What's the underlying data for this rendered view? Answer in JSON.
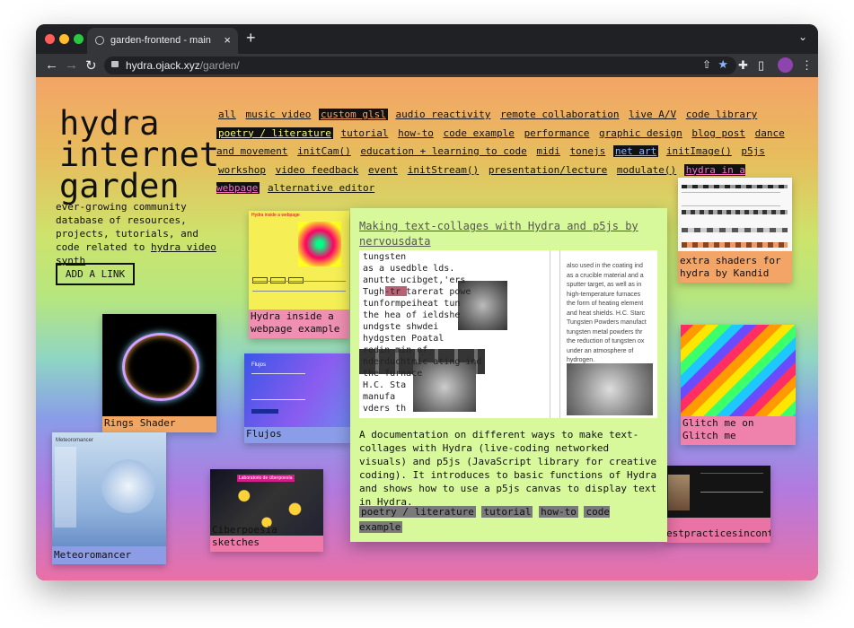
{
  "browser": {
    "tab_title": "garden-frontend - main",
    "url_host": "hydra.ojack.xyz",
    "url_path": "/garden/"
  },
  "site": {
    "logo": "hydra\ninternet\ngarden",
    "description": "ever-growing community database of resources, projects, tutorials, and code related to",
    "description_link": "hydra video synth",
    "add_link": "ADD A LINK"
  },
  "tags": [
    {
      "label": "all",
      "state": "normal"
    },
    {
      "label": "music video",
      "state": "normal"
    },
    {
      "label": "custom glsl",
      "state": "orange"
    },
    {
      "label": "audio reactivity",
      "state": "normal"
    },
    {
      "label": "remote collaboration",
      "state": "normal"
    },
    {
      "label": "live A/V",
      "state": "normal"
    },
    {
      "label": "code library",
      "state": "normal"
    },
    {
      "label": "poetry / literature",
      "state": "yellow"
    },
    {
      "label": "tutorial",
      "state": "normal"
    },
    {
      "label": "how-to",
      "state": "normal"
    },
    {
      "label": "code example",
      "state": "normal"
    },
    {
      "label": "performance",
      "state": "normal"
    },
    {
      "label": "graphic design",
      "state": "normal"
    },
    {
      "label": "blog post",
      "state": "normal"
    },
    {
      "label": "dance and movement",
      "state": "normal"
    },
    {
      "label": "initCam()",
      "state": "normal"
    },
    {
      "label": "education + learning to code",
      "state": "normal"
    },
    {
      "label": "midi",
      "state": "normal"
    },
    {
      "label": "tonejs",
      "state": "normal"
    },
    {
      "label": "net art",
      "state": "blue"
    },
    {
      "label": "initImage()",
      "state": "normal"
    },
    {
      "label": "p5js",
      "state": "normal"
    },
    {
      "label": "workshop",
      "state": "normal"
    },
    {
      "label": "video feedback",
      "state": "normal"
    },
    {
      "label": "event",
      "state": "normal"
    },
    {
      "label": "initStream()",
      "state": "normal"
    },
    {
      "label": "presentation/lecture",
      "state": "normal"
    },
    {
      "label": "modulate()",
      "state": "normal"
    },
    {
      "label": "hydra in a webpage",
      "state": "pink"
    },
    {
      "label": "alternative editor",
      "state": "normal"
    }
  ],
  "cards": {
    "hydra_webpage": {
      "caption": "Hydra inside a webpage example",
      "thumb_title": "Hydra inside a webpage"
    },
    "rings": {
      "caption": "Rings Shader"
    },
    "flujos": {
      "caption": "Flujos",
      "thumb_title": "Flujos"
    },
    "meteoromancer": {
      "caption": "Meteoromancer",
      "thumb_title": "Meteoromancer"
    },
    "ciberpoesia": {
      "caption": "Ciberpoesia sketches",
      "thumb_title": "Laboratorio de ciberpoesía"
    },
    "kandid": {
      "caption": "extra shaders for hydra by Kandid"
    },
    "glitch": {
      "caption": "Glitch me on Glitch me"
    },
    "bestpractices": {
      "caption": "estpracticesinconte"
    }
  },
  "detail": {
    "title": "Making text-collages with Hydra and p5js by nervousdata",
    "body": "A documentation on different ways to make text-collages with Hydra (live-coding networked visuals) and p5js (JavaScript library for creative coding). It introduces to basic functions of Hydra and shows how to use a p5js canvas to display text in Hydra.",
    "tags": [
      "poetry / literature",
      "tutorial",
      "how-to",
      "code example"
    ],
    "image_text_left": [
      "tungsten",
      "as a usedble lds.",
      "anutte ucibget,'ers",
      "Tugh-tr tarerat powe",
      "tunformpeiheat tun",
      "the hea of ieldshe",
      "undgste shwdei",
      "hydgsten Poatal",
      "redin min of",
      "nderduchtmic ating ind",
      "the furnace",
      "H.C. Sta",
      "manufa",
      "vders th"
    ],
    "image_text_right": [
      "also used in the coating ind",
      "as a crucible material and a",
      "sputter target, as well as in",
      "high-temperature furnaces",
      "the form of heating element",
      "and heat shields. H.C. Starc",
      "Tungsten Powders manufact",
      "tungsten metal powders thr",
      "the reduction of tungsten ox",
      "under an atmosphere of",
      "hydrogen."
    ]
  }
}
